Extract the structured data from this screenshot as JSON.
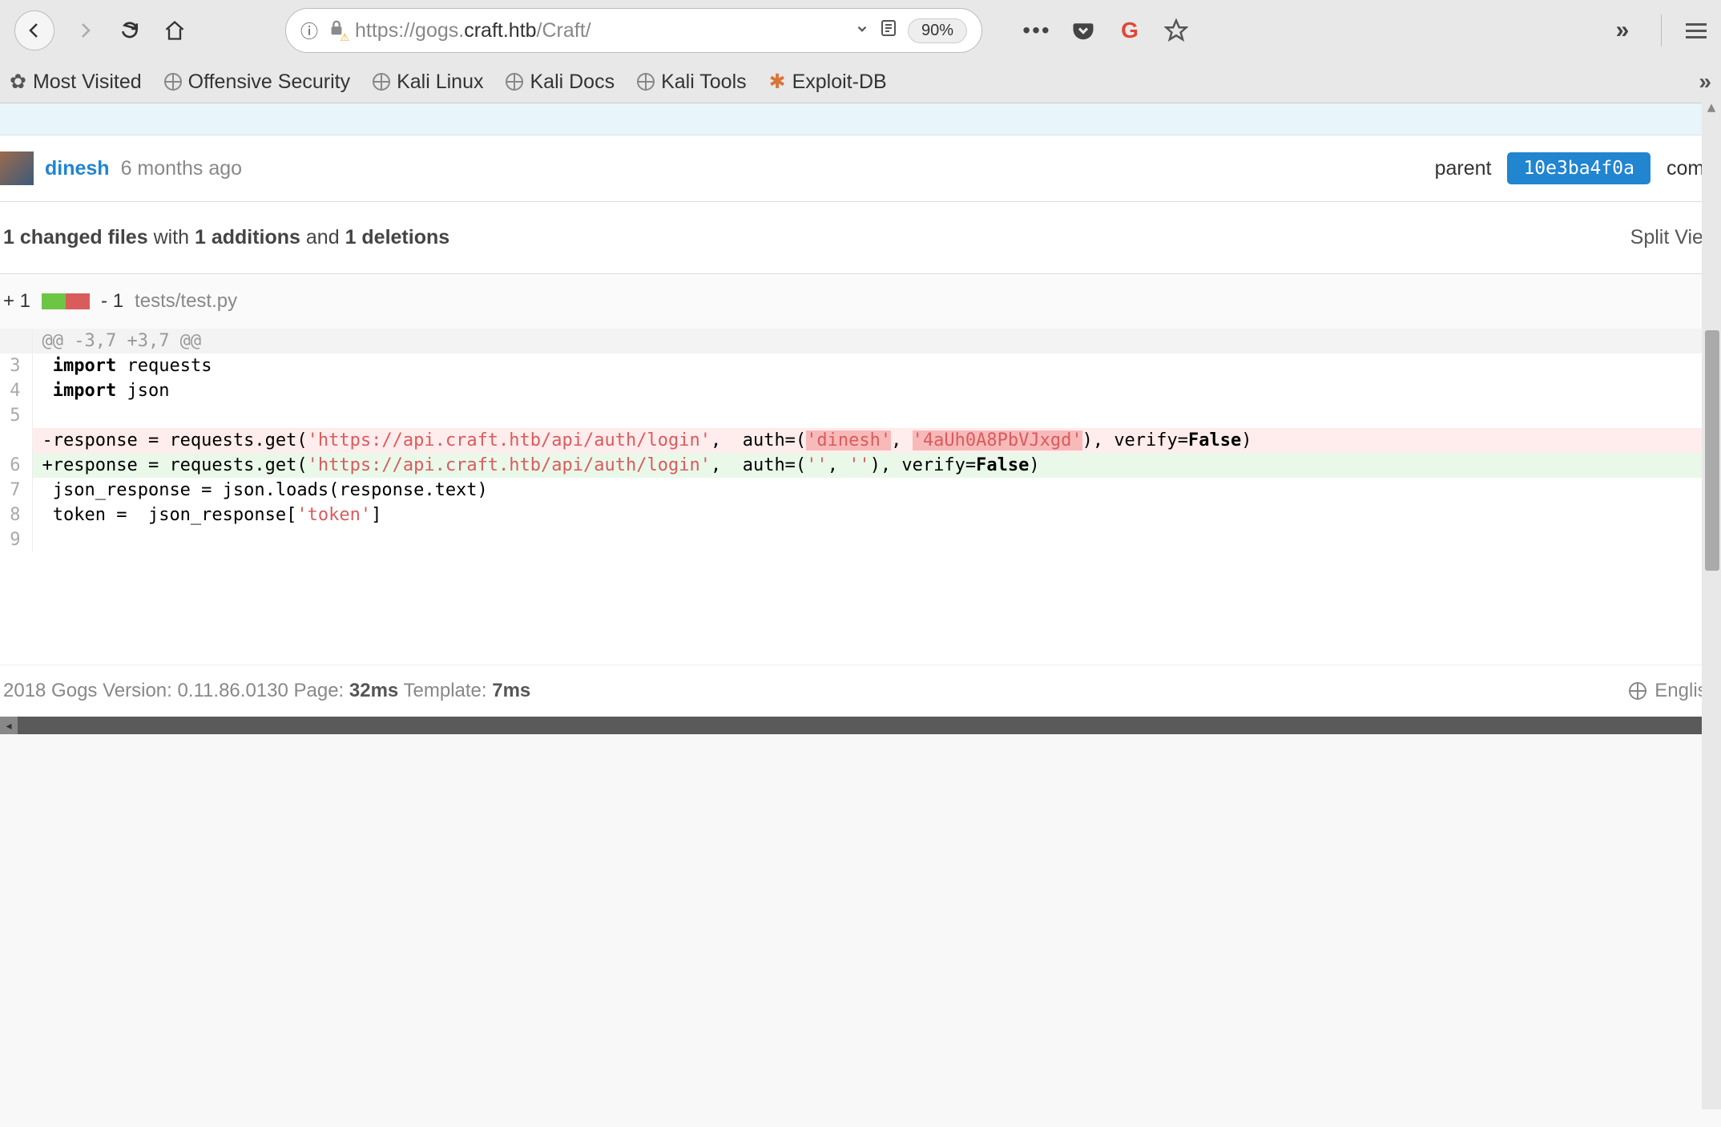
{
  "browser": {
    "url_prefix": "https://gogs.",
    "url_dark": "craft.htb",
    "url_suffix": "/Craft/",
    "zoom": "90%",
    "bookmarks": [
      {
        "icon": "⚙",
        "label": "Most Visited"
      },
      {
        "icon": "globe",
        "label": "Offensive Security"
      },
      {
        "icon": "globe",
        "label": "Kali Linux"
      },
      {
        "icon": "globe",
        "label": "Kali Docs"
      },
      {
        "icon": "globe",
        "label": "Kali Tools"
      },
      {
        "icon": "bug",
        "label": "Exploit-DB"
      }
    ]
  },
  "commit": {
    "author": "dinesh",
    "time": "6 months ago",
    "parent_label": "parent",
    "hash": "10e3ba4f0a",
    "commit_label": "comm"
  },
  "diffstats": {
    "files": "1 changed files",
    "with": " with ",
    "adds": "1 additions",
    "and": " and ",
    "dels": "1 deletions",
    "split": "Split View"
  },
  "file": {
    "add": "+ 1",
    "del": "- 1",
    "path": "tests/test.py"
  },
  "diff": {
    "hunk": "@@ -3,7 +3,7 @@",
    "lines": [
      {
        "ln": "3",
        "type": "ctx",
        "kw": "import",
        "rest": " requests"
      },
      {
        "ln": "4",
        "type": "ctx",
        "kw": "import",
        "rest": " json"
      },
      {
        "ln": "5",
        "type": "ctx",
        "kw": "",
        "rest": ""
      },
      {
        "ln": "",
        "type": "del",
        "pre": "-response = requests.get(",
        "url": "'https://api.craft.htb/api/auth/login'",
        "mid1": ",  auth=(",
        "hl1": "'dinesh'",
        "mid2": ", ",
        "hl2": "'4aUh0A8PbVJxgd'",
        "post": "), verify=",
        "kw2": "False",
        "end": ")"
      },
      {
        "ln": "6",
        "type": "add",
        "pre": "+response = requests.get(",
        "url": "'https://api.craft.htb/api/auth/login'",
        "mid1": ",  auth=(",
        "hl1": "''",
        "mid2": ", ",
        "hl2": "''",
        "post": "), verify=",
        "kw2": "False",
        "end": ")"
      },
      {
        "ln": "7",
        "type": "ctx",
        "kw": "",
        "rest": " json_response = json.loads(response.text)"
      },
      {
        "ln": "8",
        "type": "ctx",
        "pre": " token =  json_response[",
        "url": "'token'",
        "post": "]"
      },
      {
        "ln": "9",
        "type": "ctx",
        "kw": "",
        "rest": ""
      }
    ]
  },
  "footer": {
    "text1": "2018 Gogs Version: 0.11.86.0130 Page: ",
    "page": "32ms",
    "text2": " Template: ",
    "tmpl": "7ms",
    "lang": "English"
  }
}
